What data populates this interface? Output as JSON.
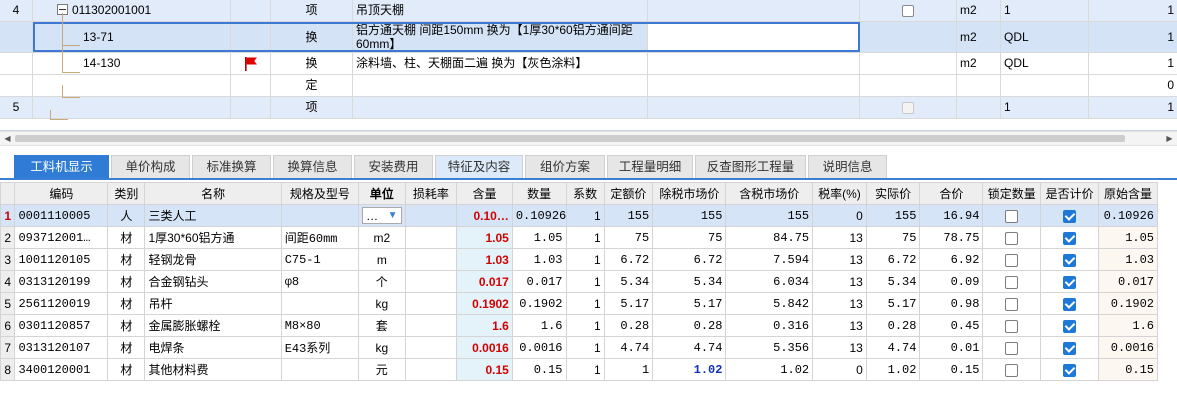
{
  "top_rows": [
    {
      "row_no": "4",
      "code": "011302001001",
      "type": "项",
      "name": "吊顶天棚",
      "unit": "m2",
      "qty": "1",
      "last": "1",
      "has_checkbox": true
    },
    {
      "row_no": "",
      "code": "13-71",
      "type": "换",
      "name_line1": "铝方通天棚 间距150mm  换为【1厚30*60铝方通间距",
      "name_line2": "60mm】",
      "unit": "m2",
      "qty": "QDL",
      "last": "1"
    },
    {
      "row_no": "",
      "code": "14-130",
      "type": "换",
      "name": "涂料墙、柱、天棚面二遍  换为【灰色涂料】",
      "unit": "m2",
      "qty": "QDL",
      "last": "1",
      "flag": "red-flag-icon"
    },
    {
      "row_no": "",
      "code": "",
      "type": "定",
      "name": "",
      "unit": "",
      "qty": "",
      "last": "0"
    },
    {
      "row_no": "5",
      "code": "",
      "type": "项",
      "name": "",
      "unit": "",
      "qty": "1",
      "last": "1",
      "has_checkbox": true
    }
  ],
  "tabs": [
    {
      "label": "工料机显示",
      "active": true
    },
    {
      "label": "单价构成"
    },
    {
      "label": "标准换算"
    },
    {
      "label": "换算信息"
    },
    {
      "label": "安装费用"
    },
    {
      "label": "特征及内容",
      "soft": true
    },
    {
      "label": "组价方案"
    },
    {
      "label": "工程量明细"
    },
    {
      "label": "反查图形工程量"
    },
    {
      "label": "说明信息"
    }
  ],
  "columns": [
    "",
    "编码",
    "类别",
    "名称",
    "规格及型号",
    "单位",
    "损耗率",
    "含量",
    "数量",
    "系数",
    "定额价",
    "除税市场价",
    "含税市场价",
    "税率(%)",
    "实际价",
    "合价",
    "锁定数量",
    "是否计价",
    "原始含量"
  ],
  "rows": [
    {
      "idx": "1",
      "code": "0001110005",
      "cat": "人",
      "name": "三类人工",
      "spec": "",
      "unit": "…",
      "loss": "",
      "qty": "0.10…",
      "num": "0.10926",
      "coef": "1",
      "quota": "155",
      "ex_tax": "155",
      "inc_tax": "155",
      "tax": "0",
      "actual": "155",
      "total": "16.94",
      "lock": false,
      "priced": true,
      "orig": "0.10926",
      "selected": true
    },
    {
      "idx": "2",
      "code": "093712001…",
      "cat": "材",
      "name": "1厚30*60铝方通",
      "spec": "间距60mm",
      "unit": "m2",
      "loss": "",
      "qty": "1.05",
      "num": "1.05",
      "coef": "1",
      "quota": "75",
      "ex_tax": "75",
      "inc_tax": "84.75",
      "tax": "13",
      "actual": "75",
      "total": "78.75",
      "lock": false,
      "priced": true,
      "orig": "1.05"
    },
    {
      "idx": "3",
      "code": "1001120105",
      "cat": "材",
      "name": "轻钢龙骨",
      "spec": "C75-1",
      "unit": "m",
      "loss": "",
      "qty": "1.03",
      "num": "1.03",
      "coef": "1",
      "quota": "6.72",
      "ex_tax": "6.72",
      "inc_tax": "7.594",
      "tax": "13",
      "actual": "6.72",
      "total": "6.92",
      "lock": false,
      "priced": true,
      "orig": "1.03"
    },
    {
      "idx": "4",
      "code": "0313120199",
      "cat": "材",
      "name": "合金钢钻头",
      "spec": "φ8",
      "unit": "个",
      "loss": "",
      "qty": "0.017",
      "num": "0.017",
      "coef": "1",
      "quota": "5.34",
      "ex_tax": "5.34",
      "inc_tax": "6.034",
      "tax": "13",
      "actual": "5.34",
      "total": "0.09",
      "lock": false,
      "priced": true,
      "orig": "0.017"
    },
    {
      "idx": "5",
      "code": "2561120019",
      "cat": "材",
      "name": "吊杆",
      "spec": "",
      "unit": "kg",
      "loss": "",
      "qty": "0.1902",
      "num": "0.1902",
      "coef": "1",
      "quota": "5.17",
      "ex_tax": "5.17",
      "inc_tax": "5.842",
      "tax": "13",
      "actual": "5.17",
      "total": "0.98",
      "lock": false,
      "priced": true,
      "orig": "0.1902"
    },
    {
      "idx": "6",
      "code": "0301120857",
      "cat": "材",
      "name": "金属膨胀螺栓",
      "spec": "M8×80",
      "unit": "套",
      "loss": "",
      "qty": "1.6",
      "num": "1.6",
      "coef": "1",
      "quota": "0.28",
      "ex_tax": "0.28",
      "inc_tax": "0.316",
      "tax": "13",
      "actual": "0.28",
      "total": "0.45",
      "lock": false,
      "priced": true,
      "orig": "1.6"
    },
    {
      "idx": "7",
      "code": "0313120107",
      "cat": "材",
      "name": "电焊条",
      "spec": "E43系列",
      "unit": "kg",
      "loss": "",
      "qty": "0.0016",
      "num": "0.0016",
      "coef": "1",
      "quota": "4.74",
      "ex_tax": "4.74",
      "inc_tax": "5.356",
      "tax": "13",
      "actual": "4.74",
      "total": "0.01",
      "lock": false,
      "priced": true,
      "orig": "0.0016"
    },
    {
      "idx": "8",
      "code": "3400120001",
      "cat": "材",
      "name": "其他材料费",
      "spec": "",
      "unit": "元",
      "loss": "",
      "qty": "0.15",
      "num": "0.15",
      "coef": "1",
      "quota": "1",
      "ex_tax": "1.02",
      "inc_tax": "1.02",
      "tax": "0",
      "actual": "1.02",
      "total": "0.15",
      "lock": false,
      "priced": true,
      "orig": "0.15",
      "ex_tax_blue": true
    }
  ],
  "colors": {
    "accent": "#2f7bd5",
    "qty_red": "#d40000",
    "blue_value": "#1030c0"
  }
}
